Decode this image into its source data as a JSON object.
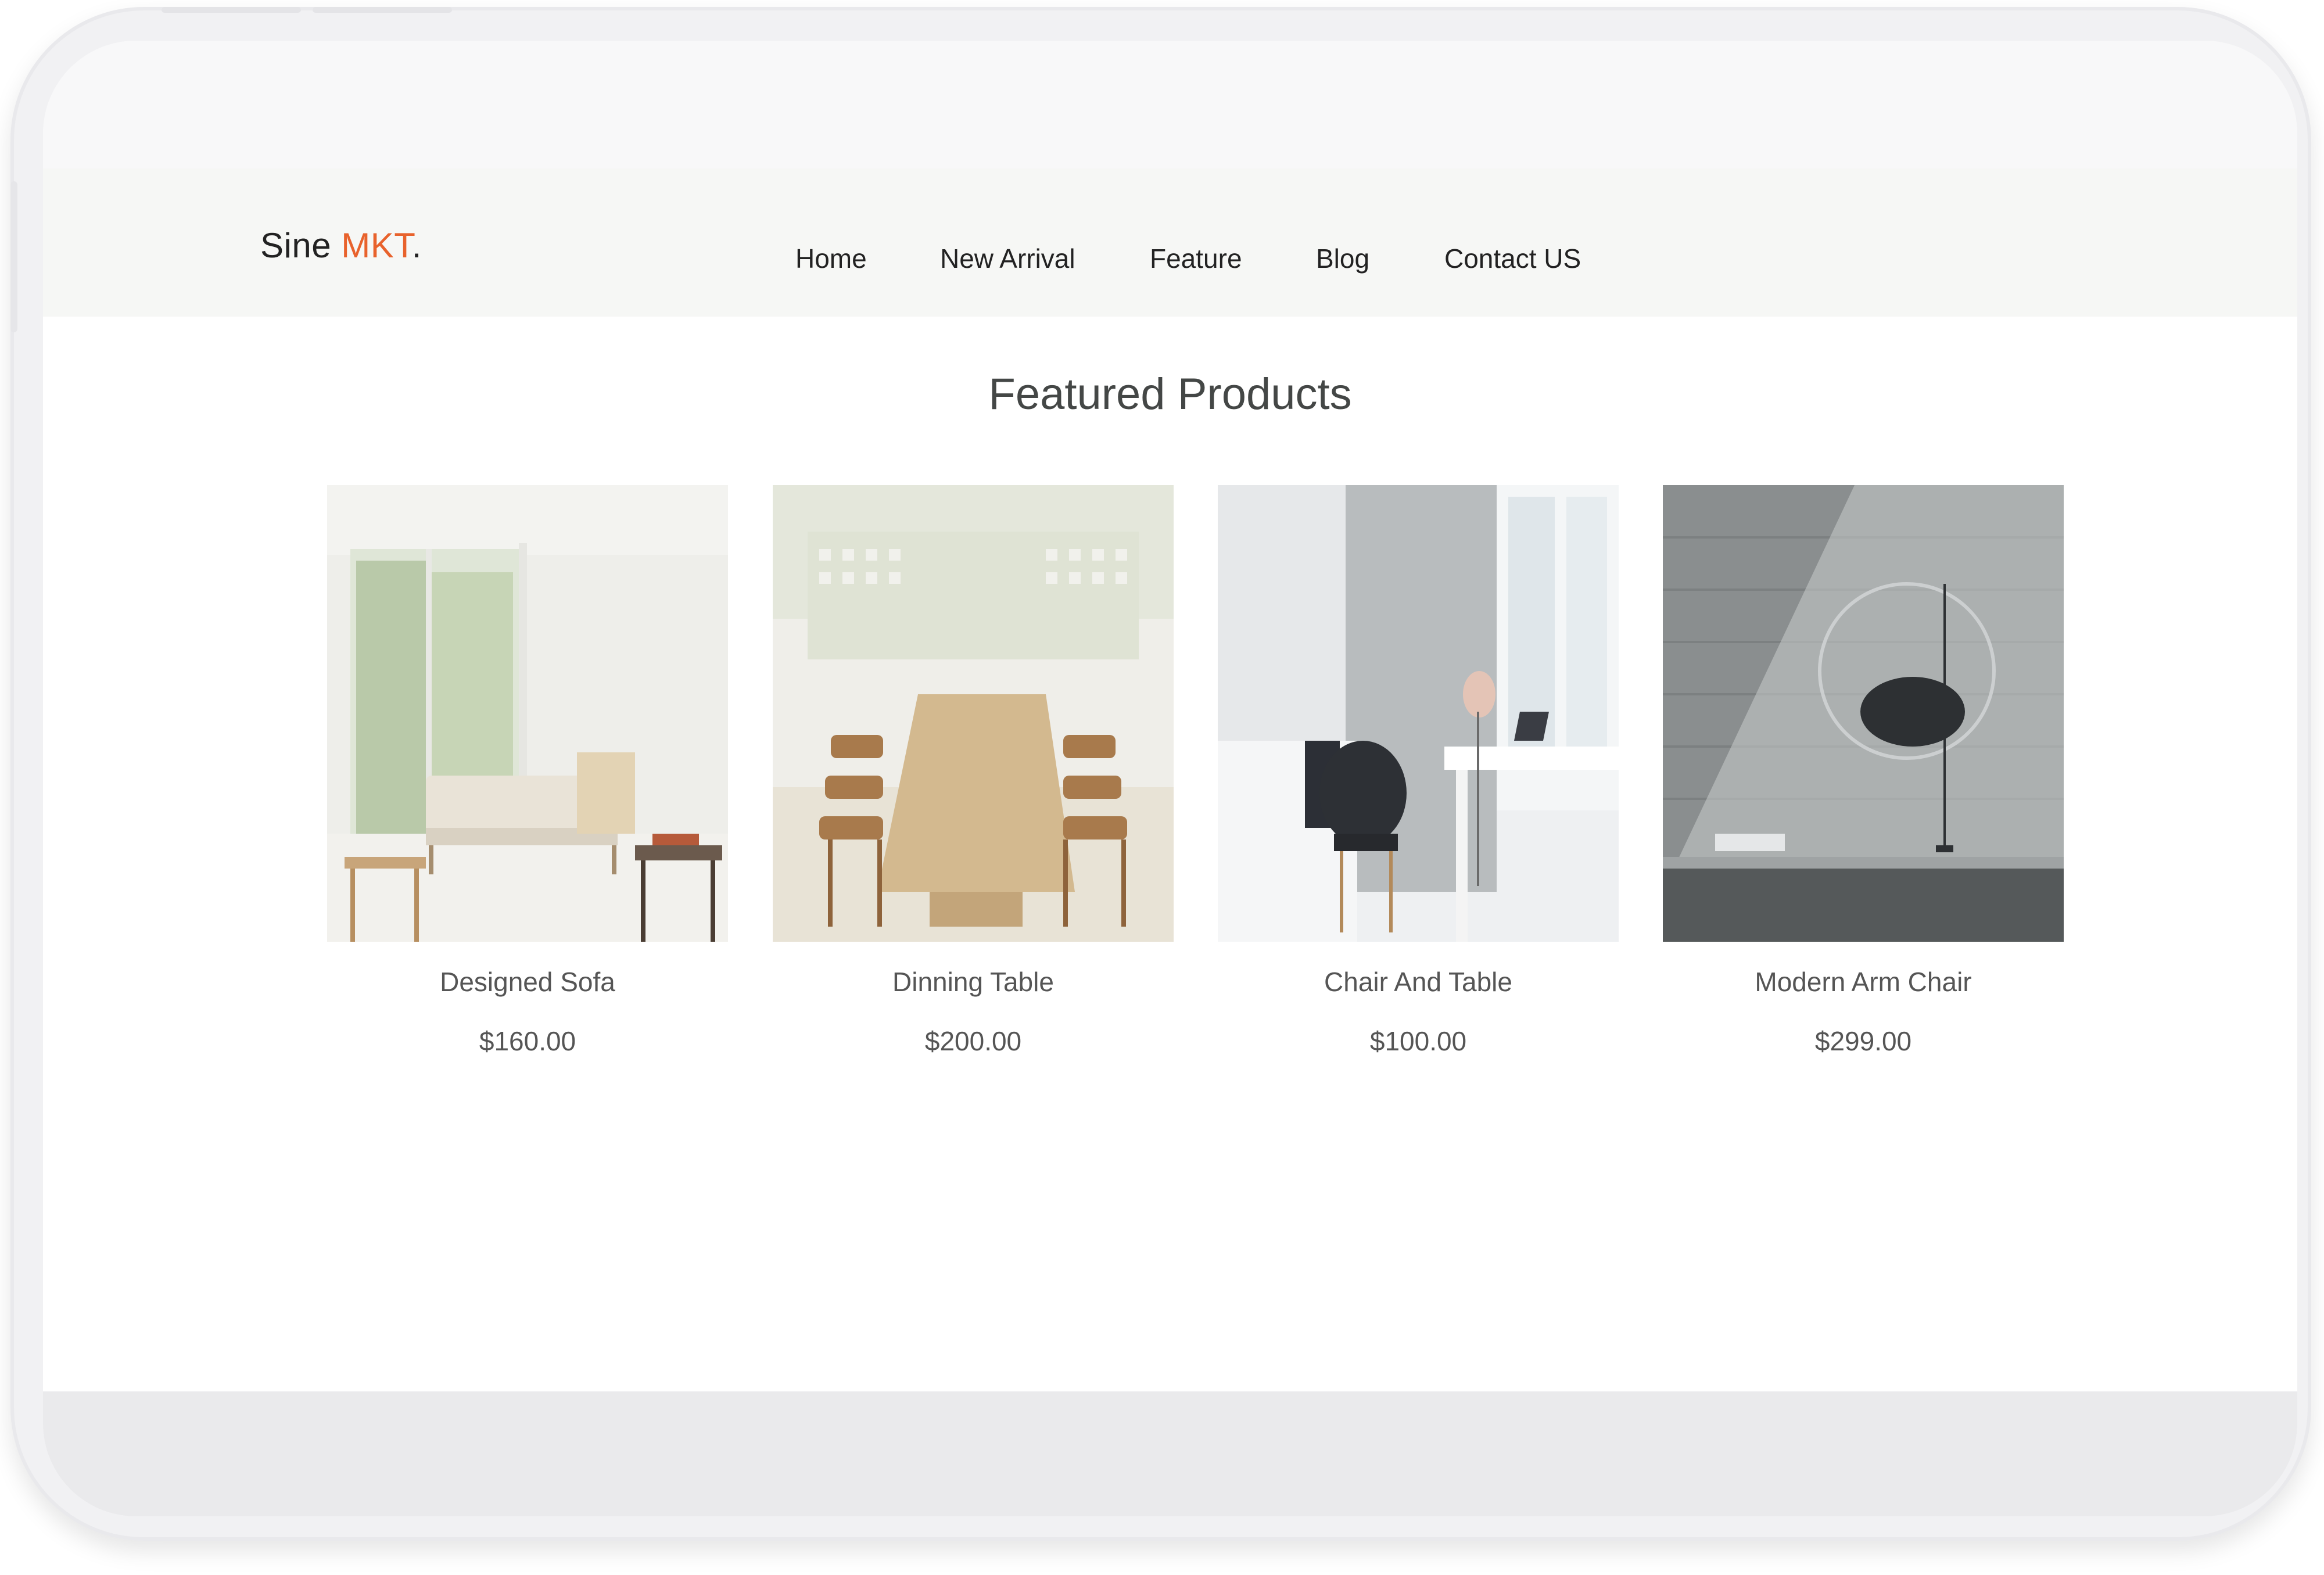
{
  "brand": {
    "name": "Sine ",
    "accent": "MKT",
    "dot": "."
  },
  "nav": {
    "items": [
      {
        "label": "Home"
      },
      {
        "label": "New Arrival"
      },
      {
        "label": "Feature"
      },
      {
        "label": "Blog"
      },
      {
        "label": "Contact US"
      }
    ]
  },
  "section": {
    "title": "Featured Products"
  },
  "products": [
    {
      "name": "Designed Sofa",
      "price": "$160.00"
    },
    {
      "name": "Dinning Table",
      "price": "$200.00"
    },
    {
      "name": "Chair And Table",
      "price": "$100.00"
    },
    {
      "name": "Modern Arm Chair",
      "price": "$299.00"
    }
  ],
  "colors": {
    "accent": "#e8622c",
    "nav_bg": "#f6f7f5",
    "text_dark": "#222222",
    "text_muted": "#555555"
  }
}
